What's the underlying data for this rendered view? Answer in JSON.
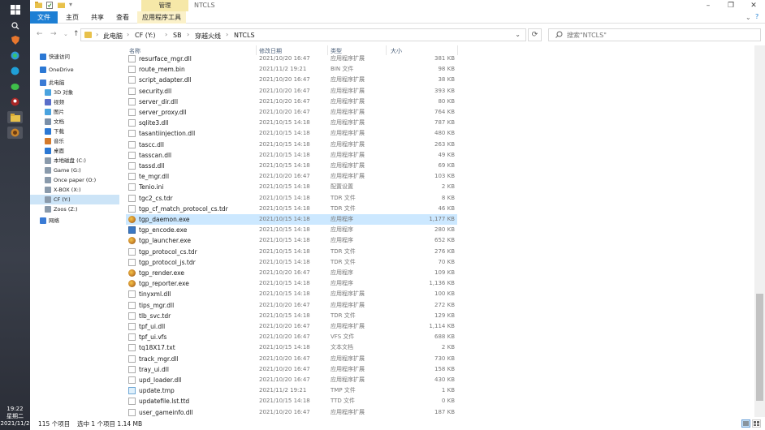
{
  "taskbar": {
    "time": "19:22",
    "weekday": "星期二",
    "date": "2021/11/2"
  },
  "window": {
    "title": "NTCLS",
    "manage_tab": "管理",
    "ribbon_tabs": [
      "文件",
      "主页",
      "共享",
      "查看",
      "应用程序工具"
    ]
  },
  "address": {
    "crumbs": [
      "此电脑",
      "CF (Y:)",
      "SB",
      "穿越火线",
      "NTCLS"
    ]
  },
  "search": {
    "placeholder": "搜索\"NTCLS\""
  },
  "navpane": {
    "items": [
      {
        "label": "快速访问",
        "icon": "star-icon",
        "level": 0
      },
      {
        "label": "OneDrive",
        "icon": "cloud-icon",
        "level": 0
      },
      {
        "label": "此电脑",
        "icon": "pc-icon",
        "level": 0
      },
      {
        "label": "3D 对象",
        "icon": "cube-icon",
        "level": 1
      },
      {
        "label": "视频",
        "icon": "video-icon",
        "level": 1
      },
      {
        "label": "图片",
        "icon": "picture-icon",
        "level": 1
      },
      {
        "label": "文档",
        "icon": "document-icon",
        "level": 1
      },
      {
        "label": "下载",
        "icon": "download-icon",
        "level": 1
      },
      {
        "label": "音乐",
        "icon": "music-icon",
        "level": 1
      },
      {
        "label": "桌面",
        "icon": "desktop-icon",
        "level": 1
      },
      {
        "label": "本地磁盘 (C:)",
        "icon": "drive-icon",
        "level": 1
      },
      {
        "label": "Game (G:)",
        "icon": "drive-icon",
        "level": 1
      },
      {
        "label": "Once paper (O:)",
        "icon": "drive-icon",
        "level": 1
      },
      {
        "label": "X-BOX (X:)",
        "icon": "drive-icon",
        "level": 1
      },
      {
        "label": "CF (Y:)",
        "icon": "drive-icon",
        "level": 1,
        "selected": true
      },
      {
        "label": "Zoos (Z:)",
        "icon": "drive-icon",
        "level": 1
      },
      {
        "label": "网络",
        "icon": "network-icon",
        "level": 0
      }
    ]
  },
  "columns": {
    "name": "名称",
    "date": "修改日期",
    "type": "类型",
    "size": "大小"
  },
  "files": [
    {
      "name": "resurface_mgr.dll",
      "date": "2021/10/20 16:47",
      "type": "应用程序扩展",
      "size": "381 KB",
      "icon": "file"
    },
    {
      "name": "route_mem.bin",
      "date": "2021/11/2 19:21",
      "type": "BIN 文件",
      "size": "98 KB",
      "icon": "file"
    },
    {
      "name": "script_adapter.dll",
      "date": "2021/10/20 16:47",
      "type": "应用程序扩展",
      "size": "38 KB",
      "icon": "file"
    },
    {
      "name": "security.dll",
      "date": "2021/10/20 16:47",
      "type": "应用程序扩展",
      "size": "393 KB",
      "icon": "file"
    },
    {
      "name": "server_dir.dll",
      "date": "2021/10/20 16:47",
      "type": "应用程序扩展",
      "size": "80 KB",
      "icon": "file"
    },
    {
      "name": "server_proxy.dll",
      "date": "2021/10/20 16:47",
      "type": "应用程序扩展",
      "size": "764 KB",
      "icon": "file"
    },
    {
      "name": "sqlite3.dll",
      "date": "2021/10/15 14:18",
      "type": "应用程序扩展",
      "size": "787 KB",
      "icon": "file"
    },
    {
      "name": "tasantiinjection.dll",
      "date": "2021/10/15 14:18",
      "type": "应用程序扩展",
      "size": "480 KB",
      "icon": "file"
    },
    {
      "name": "tascc.dll",
      "date": "2021/10/15 14:18",
      "type": "应用程序扩展",
      "size": "263 KB",
      "icon": "file"
    },
    {
      "name": "tasscan.dll",
      "date": "2021/10/15 14:18",
      "type": "应用程序扩展",
      "size": "49 KB",
      "icon": "file"
    },
    {
      "name": "tassd.dll",
      "date": "2021/10/15 14:18",
      "type": "应用程序扩展",
      "size": "69 KB",
      "icon": "file"
    },
    {
      "name": "te_mgr.dll",
      "date": "2021/10/20 16:47",
      "type": "应用程序扩展",
      "size": "103 KB",
      "icon": "file"
    },
    {
      "name": "Tenio.ini",
      "date": "2021/10/15 14:18",
      "type": "配置设置",
      "size": "2 KB",
      "icon": "file"
    },
    {
      "name": "tgc2_cs.tdr",
      "date": "2021/10/15 14:18",
      "type": "TDR 文件",
      "size": "8 KB",
      "icon": "file"
    },
    {
      "name": "tgp_cf_match_protocol_cs.tdr",
      "date": "2021/10/15 14:18",
      "type": "TDR 文件",
      "size": "46 KB",
      "icon": "file"
    },
    {
      "name": "tgp_daemon.exe",
      "date": "2021/10/15 14:18",
      "type": "应用程序",
      "size": "1,177 KB",
      "icon": "exe",
      "selected": true
    },
    {
      "name": "tgp_encode.exe",
      "date": "2021/10/15 14:18",
      "type": "应用程序",
      "size": "280 KB",
      "icon": "blue"
    },
    {
      "name": "tgp_launcher.exe",
      "date": "2021/10/15 14:18",
      "type": "应用程序",
      "size": "652 KB",
      "icon": "exe"
    },
    {
      "name": "tgp_protocol_cs.tdr",
      "date": "2021/10/15 14:18",
      "type": "TDR 文件",
      "size": "276 KB",
      "icon": "file"
    },
    {
      "name": "tgp_protocol_js.tdr",
      "date": "2021/10/15 14:18",
      "type": "TDR 文件",
      "size": "70 KB",
      "icon": "file"
    },
    {
      "name": "tgp_render.exe",
      "date": "2021/10/20 16:47",
      "type": "应用程序",
      "size": "109 KB",
      "icon": "exe"
    },
    {
      "name": "tgp_reporter.exe",
      "date": "2021/10/15 14:18",
      "type": "应用程序",
      "size": "1,136 KB",
      "icon": "exe"
    },
    {
      "name": "tinyxml.dll",
      "date": "2021/10/15 14:18",
      "type": "应用程序扩展",
      "size": "100 KB",
      "icon": "file"
    },
    {
      "name": "tips_mgr.dll",
      "date": "2021/10/20 16:47",
      "type": "应用程序扩展",
      "size": "272 KB",
      "icon": "file"
    },
    {
      "name": "tlb_svc.tdr",
      "date": "2021/10/15 14:18",
      "type": "TDR 文件",
      "size": "129 KB",
      "icon": "file"
    },
    {
      "name": "tpf_ui.dll",
      "date": "2021/10/20 16:47",
      "type": "应用程序扩展",
      "size": "1,114 KB",
      "icon": "file"
    },
    {
      "name": "tpf_ui.vfs",
      "date": "2021/10/20 16:47",
      "type": "VFS 文件",
      "size": "688 KB",
      "icon": "file"
    },
    {
      "name": "tq18X17.txt",
      "date": "2021/10/15 14:18",
      "type": "文本文档",
      "size": "2 KB",
      "icon": "file"
    },
    {
      "name": "track_mgr.dll",
      "date": "2021/10/20 16:47",
      "type": "应用程序扩展",
      "size": "730 KB",
      "icon": "file"
    },
    {
      "name": "tray_ui.dll",
      "date": "2021/10/20 16:47",
      "type": "应用程序扩展",
      "size": "158 KB",
      "icon": "file"
    },
    {
      "name": "upd_loader.dll",
      "date": "2021/10/20 16:47",
      "type": "应用程序扩展",
      "size": "430 KB",
      "icon": "file"
    },
    {
      "name": "update.tmp",
      "date": "2021/11/2 19:21",
      "type": "TMP 文件",
      "size": "1 KB",
      "icon": "tmp"
    },
    {
      "name": "updatefile.lst.ttd",
      "date": "2021/10/15 14:18",
      "type": "TTD 文件",
      "size": "0 KB",
      "icon": "file"
    },
    {
      "name": "user_gameinfo.dll",
      "date": "2021/10/20 16:47",
      "type": "应用程序扩展",
      "size": "187 KB",
      "icon": "file"
    }
  ],
  "status": {
    "item_count": "115 个项目",
    "selection": "选中 1 个项目  1.14 MB"
  },
  "colors": {
    "file_tab": "#1d7fd4",
    "selection": "#cce8ff",
    "nav_selected": "#cce4f7"
  }
}
